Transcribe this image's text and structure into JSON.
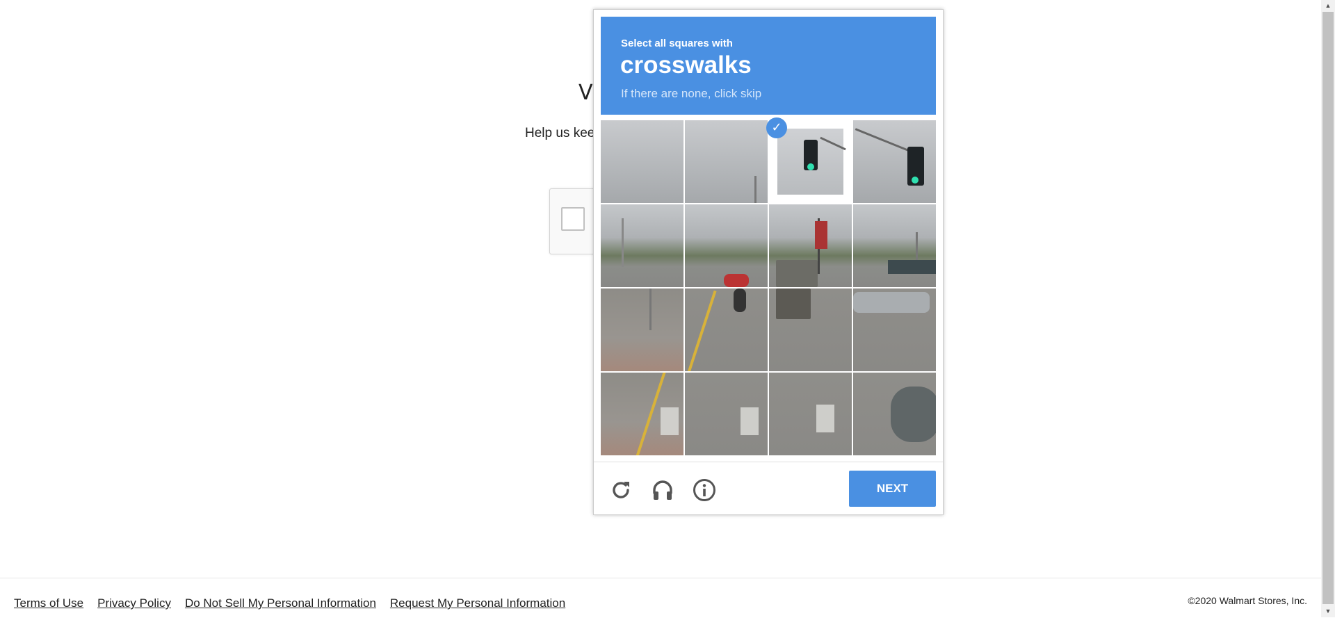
{
  "background": {
    "title_partial": "V",
    "help_text_partial": "Help us kee"
  },
  "captcha": {
    "instruction": "Select all squares with",
    "target": "crosswalks",
    "hint": "If there are none, click skip",
    "next_label": "NEXT",
    "selected_tiles": [
      2
    ],
    "header_color": "#4a90e2",
    "icons": [
      "reload-icon",
      "audio-icon",
      "info-icon"
    ]
  },
  "footer": {
    "links": [
      "Terms of Use",
      "Privacy Policy",
      "Do Not Sell My Personal Information",
      "Request My Personal Information"
    ],
    "copyright": "©2020 Walmart Stores, Inc."
  }
}
